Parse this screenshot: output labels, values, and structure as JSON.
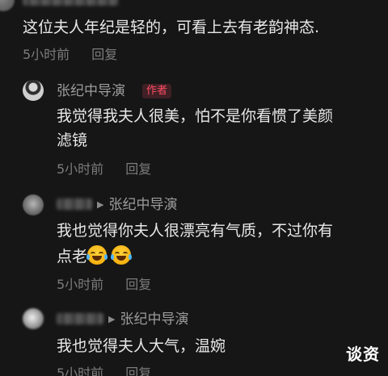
{
  "comments": [
    {
      "text": "这位夫人年纪是轻的，可看上去有老韵神态.",
      "time": "5小时前",
      "reply": "回复"
    },
    {
      "username": "张纪中导演",
      "badge": "作者",
      "text_line1": "我觉得我夫人很美，怕不是你看惯了美颜",
      "text_line2": "滤镜",
      "time": "5小时前",
      "reply": "回复"
    },
    {
      "username_blurred": "鳳儿",
      "reply_to": "张纪中导演",
      "text_line1": "我也觉得你夫人很漂亮有气质，不过你有",
      "text_line2": "点老",
      "time": "5小时前",
      "reply": "回复"
    },
    {
      "username_blurred": "宝心翼",
      "reply_to": "张纪中导演",
      "text": "我也觉得夫人大气，温婉",
      "time": "5小时前",
      "reply": "回复"
    }
  ],
  "icons": {
    "reply_arrow": "▶",
    "emoji": "crying-laughing-emoji"
  },
  "colors": {
    "background": "#161616",
    "text": "#e8e8e8",
    "meta": "#7c7c7c",
    "author_badge": "#ff4d67"
  },
  "watermark": "谈资"
}
